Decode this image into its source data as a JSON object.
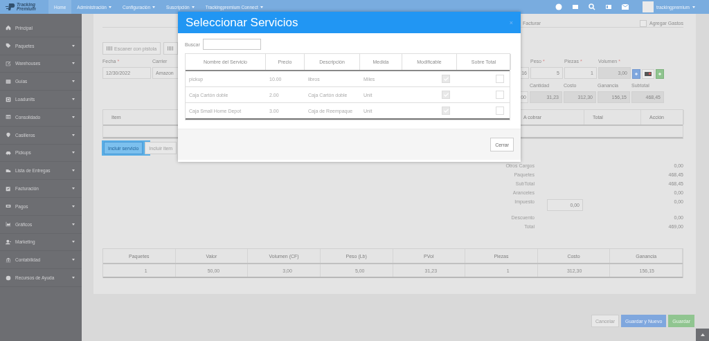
{
  "navbar": {
    "logo": [
      "Tracking",
      "Premium"
    ],
    "items": [
      {
        "label": "Home",
        "selected": true,
        "dropdown": false
      },
      {
        "label": "Administración",
        "selected": false,
        "dropdown": true
      },
      {
        "label": "Configuración",
        "selected": false,
        "dropdown": true
      },
      {
        "label": "Suscripción",
        "selected": false,
        "dropdown": true
      },
      {
        "label": "Trackingpremium Connect",
        "selected": false,
        "dropdown": true
      }
    ],
    "user": "trackingpremium"
  },
  "sidebar": {
    "items": [
      {
        "label": "Principal",
        "expandable": false
      },
      {
        "label": "Paquetes",
        "expandable": true
      },
      {
        "label": "Warehouses",
        "expandable": true
      },
      {
        "label": "Guías",
        "expandable": true
      },
      {
        "label": "Loadunits",
        "expandable": true
      },
      {
        "label": "Consolidado",
        "expandable": true
      },
      {
        "label": "Casilleros",
        "expandable": true
      },
      {
        "label": "Pickups",
        "expandable": true
      },
      {
        "label": "Lista de Entregas",
        "expandable": true
      },
      {
        "label": "Facturación",
        "expandable": true
      },
      {
        "label": "Pagos",
        "expandable": true
      },
      {
        "label": "Gráficos",
        "expandable": true
      },
      {
        "label": "Marketing",
        "expandable": true
      },
      {
        "label": "Contabilidad",
        "expandable": true
      },
      {
        "label": "Recursos de Ayuda",
        "expandable": true
      }
    ]
  },
  "form": {
    "facturar_label": "Facturar",
    "agregar_gastos": {
      "label": "Agregar Gastos",
      "checked": false
    },
    "scan_button": "Escaner con pistola",
    "fields": [
      {
        "label": "Fecha",
        "mark": "*",
        "value": "12/30/2022"
      },
      {
        "label": "Carrier",
        "value": "Amazon"
      }
    ],
    "cut_values": [
      "16",
      "00"
    ],
    "measures": [
      {
        "label": "Peso",
        "mark": "*",
        "value": "5",
        "readonly": false
      },
      {
        "label": "Piezas",
        "mark": "*",
        "value": "1",
        "readonly": false
      },
      {
        "label": "Volumen",
        "mark": "*",
        "value": "3,00",
        "readonly": true
      }
    ],
    "amounts": [
      {
        "label": "Cantidad",
        "value": "31,23"
      },
      {
        "label": "Costo",
        "value": "312,30"
      },
      {
        "label": "Ganancia",
        "value": "156,15"
      },
      {
        "label": "Subtotal",
        "value": "468,45"
      }
    ],
    "items_table": {
      "columns": [
        "Item",
        "A cobrar",
        "Total",
        "Acción"
      ]
    },
    "include_buttons": [
      {
        "label": "Incluir servicio",
        "highlighted": true
      },
      {
        "label": "Incluir item",
        "highlighted": false
      }
    ],
    "totals": [
      {
        "label": "Otros Cargos",
        "value": "0,00"
      },
      {
        "label": "Paquetes",
        "value": "468,45"
      },
      {
        "label": "SubTotal",
        "value": "468,45"
      },
      {
        "label": "Aranceles",
        "value": "0,00"
      },
      {
        "label": "Impuesto",
        "value": "0,00",
        "input": "0,00"
      },
      {
        "label": "Descuento",
        "value": "0,00"
      },
      {
        "label": "Total",
        "value": "469,00"
      }
    ]
  },
  "summary_table": {
    "columns": [
      "Paquetes",
      "Valor",
      "Volumen (CF)",
      "Peso (Lb)",
      "PVol",
      "Piezas",
      "Costo",
      "Ganancia"
    ],
    "row": [
      "1",
      "50,00",
      "3,00",
      "5,00",
      "31,23",
      "1",
      "312,30",
      "156,15"
    ]
  },
  "actions": [
    {
      "label": "Cancelar",
      "kind": "default"
    },
    {
      "label": "Guardar y Nuevo",
      "kind": "primary"
    },
    {
      "label": "Guardar",
      "kind": "success"
    }
  ],
  "modal": {
    "title": "Seleccionar Servicios",
    "close": "×",
    "search_label": "Buscar",
    "columns": [
      "Nombre del Servicio",
      "Precio",
      "Descripción",
      "Medida",
      "Modificable",
      "Sobre Total"
    ],
    "rows": [
      {
        "name": "pickup",
        "price": "10.00",
        "description": "libros",
        "unit": "Miles",
        "modifiable": true,
        "over_total": false
      },
      {
        "name": "Caja Cartón doble",
        "price": "2.00",
        "description": "Caja Cartón doble",
        "unit": "Unit",
        "modifiable": true,
        "over_total": false
      },
      {
        "name": "Caja Small Home Depot",
        "price": "3.00",
        "description": "Caja de Reempaque",
        "unit": "Unit",
        "modifiable": true,
        "over_total": false
      }
    ],
    "close_button": "Cerrar"
  }
}
